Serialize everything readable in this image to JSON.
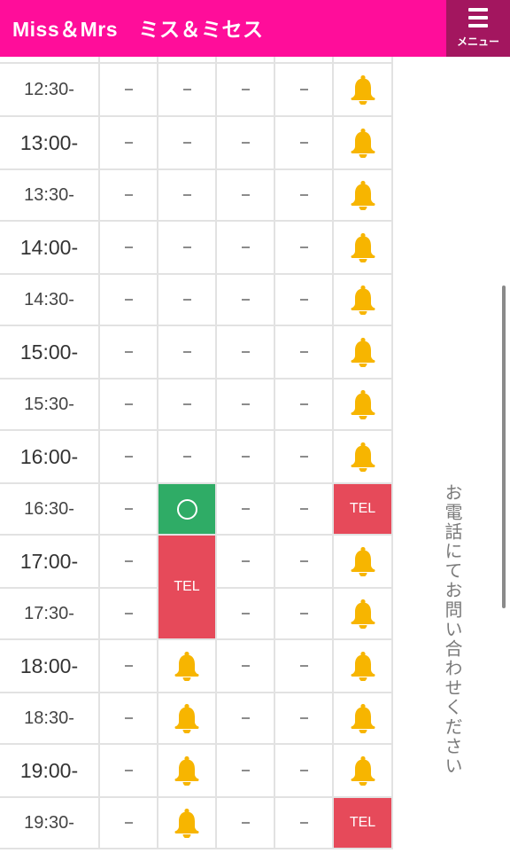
{
  "header": {
    "brand": "Miss＆Mrs　ミス＆ミセス",
    "menu_label": "メニュー",
    "bg_color": "#ff0d9a",
    "menu_bg_color": "#a3165f"
  },
  "schedule": {
    "rows": [
      {
        "time": "12:30-",
        "cells": [
          "dash",
          "dash",
          "dash",
          "dash",
          "bell"
        ]
      },
      {
        "time": "13:00-",
        "cells": [
          "dash",
          "dash",
          "dash",
          "dash",
          "bell"
        ]
      },
      {
        "time": "13:30-",
        "cells": [
          "dash",
          "dash",
          "dash",
          "dash",
          "bell"
        ]
      },
      {
        "time": "14:00-",
        "cells": [
          "dash",
          "dash",
          "dash",
          "dash",
          "bell"
        ]
      },
      {
        "time": "14:30-",
        "cells": [
          "dash",
          "dash",
          "dash",
          "dash",
          "bell"
        ]
      },
      {
        "time": "15:00-",
        "cells": [
          "dash",
          "dash",
          "dash",
          "dash",
          "bell"
        ]
      },
      {
        "time": "15:30-",
        "cells": [
          "dash",
          "dash",
          "dash",
          "dash",
          "bell"
        ]
      },
      {
        "time": "16:00-",
        "cells": [
          "dash",
          "dash",
          "dash",
          "dash",
          "bell"
        ]
      },
      {
        "time": "16:30-",
        "cells": [
          "dash",
          "circle",
          "dash",
          "dash",
          "tel"
        ]
      },
      {
        "time": "17:00-",
        "cells": [
          "dash",
          "tel-merged",
          "dash",
          "dash",
          "bell"
        ]
      },
      {
        "time": "17:30-",
        "cells": [
          "dash",
          "tel-merged",
          "dash",
          "dash",
          "bell"
        ]
      },
      {
        "time": "18:00-",
        "cells": [
          "dash",
          "bell",
          "dash",
          "dash",
          "bell"
        ]
      },
      {
        "time": "18:30-",
        "cells": [
          "dash",
          "bell",
          "dash",
          "dash",
          "bell"
        ]
      },
      {
        "time": "19:00-",
        "cells": [
          "dash",
          "bell",
          "dash",
          "dash",
          "bell"
        ]
      },
      {
        "time": "19:30-",
        "cells": [
          "dash",
          "bell",
          "dash",
          "dash",
          "tel"
        ]
      }
    ],
    "tel_label": "TEL",
    "colors": {
      "tel": "#e64a5a",
      "available": "#2fac66",
      "bell": "#f7b500"
    }
  },
  "note": "お電話にてお問い合わせください"
}
